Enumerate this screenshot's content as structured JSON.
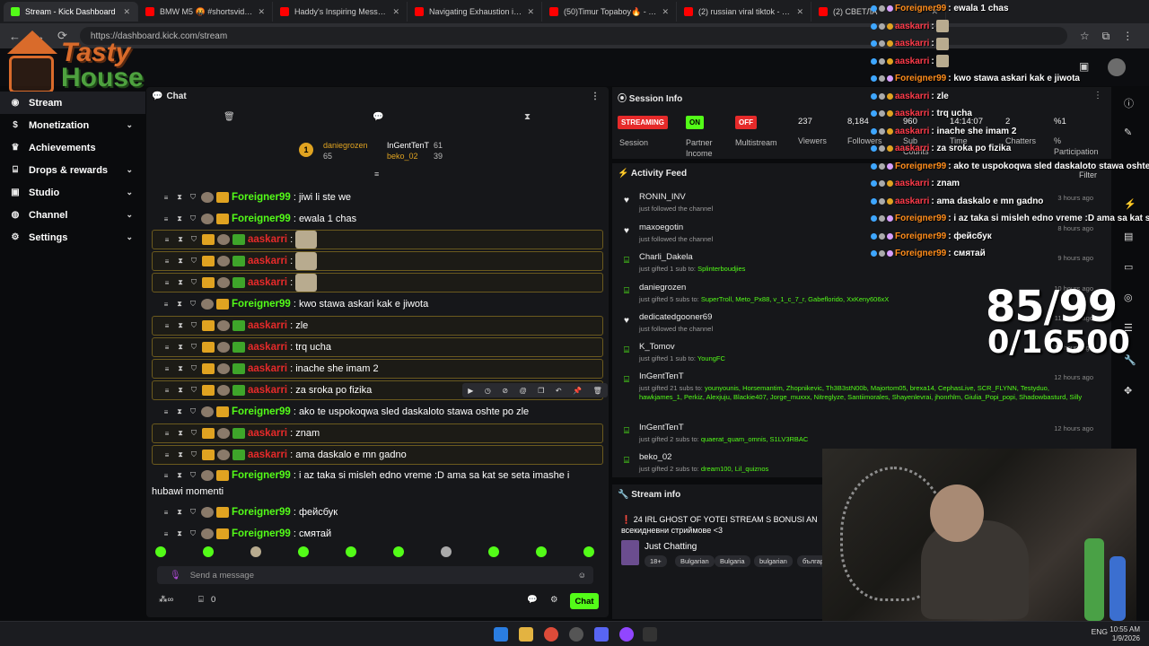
{
  "browser": {
    "tabs": [
      {
        "title": "Stream - Kick Dashboard",
        "color": "#53fc18",
        "active": true
      },
      {
        "title": "BMW M5 🤬 #shortsvideo",
        "color": "#ff0000"
      },
      {
        "title": "Haddy's Inspiring Message Aft",
        "color": "#ff0000"
      },
      {
        "title": "Navigating Exhaustion in Mode",
        "color": "#ff0000"
      },
      {
        "title": "(50)Timur Topaboy🔥 - оригин",
        "color": "#ff0000"
      },
      {
        "title": "(2) russian viral tiktok - YouTub",
        "color": "#ff0000"
      },
      {
        "title": "(2) СВЕТЛА",
        "color": "#ff0000"
      }
    ],
    "url": "https://dashboard.kick.com/stream"
  },
  "logo": {
    "line1": "Tasty",
    "line2": "House"
  },
  "sidebar": {
    "items": [
      {
        "label": "Stream",
        "icon": "broadcast-icon",
        "selected": true
      },
      {
        "label": "Monetization",
        "icon": "dollar-icon",
        "chevron": true
      },
      {
        "label": "Achievements",
        "icon": "trophy-icon"
      },
      {
        "label": "Drops & rewards",
        "icon": "gift-icon",
        "chevron": true
      },
      {
        "label": "Studio",
        "icon": "studio-icon",
        "chevron": true
      },
      {
        "label": "Channel",
        "icon": "user-icon",
        "chevron": true
      },
      {
        "label": "Settings",
        "icon": "gear-icon",
        "chevron": true
      }
    ]
  },
  "chat": {
    "title": "Chat",
    "leaders": [
      {
        "name": "daniegrozen",
        "count": "65"
      },
      {
        "name": "InGentTenT",
        "count": "61"
      },
      {
        "name": "beko_02",
        "count": "39"
      }
    ],
    "rank": "1",
    "messages": [
      {
        "user": "Foreigner99",
        "text": ": jiwi li ste we",
        "style": "green",
        "hl": false,
        "emote": false
      },
      {
        "user": "Foreigner99",
        "text": ": ewala 1 chas",
        "style": "green",
        "hl": false,
        "emote": false
      },
      {
        "user": "aaskarri",
        "text": ":",
        "style": "red",
        "hl": true,
        "emote": true
      },
      {
        "user": "aaskarri",
        "text": ":",
        "style": "red",
        "hl": true,
        "emote": true
      },
      {
        "user": "aaskarri",
        "text": ":",
        "style": "red",
        "hl": true,
        "emote": true
      },
      {
        "user": "Foreigner99",
        "text": ": kwo stawa askari kak e jiwota",
        "style": "green",
        "hl": false,
        "emote": false
      },
      {
        "user": "aaskarri",
        "text": ": zle",
        "style": "red",
        "hl": true,
        "emote": false
      },
      {
        "user": "aaskarri",
        "text": ": trq ucha",
        "style": "red",
        "hl": true,
        "emote": false
      },
      {
        "user": "aaskarri",
        "text": ": inache she imam 2",
        "style": "red",
        "hl": true,
        "emote": false
      },
      {
        "user": "aaskarri",
        "text": ": za sroka po fizika",
        "style": "red",
        "hl": true,
        "emote": false
      },
      {
        "user": "Foreigner99",
        "text": ": ako te uspokoqwa sled daskaloto stawa oshte po zle",
        "style": "green",
        "hl": false,
        "emote": false
      },
      {
        "user": "aaskarri",
        "text": ": znam",
        "style": "red",
        "hl": true,
        "emote": false
      },
      {
        "user": "aaskarri",
        "text": ": ama daskalo e mn gadno",
        "style": "red",
        "hl": true,
        "emote": false
      },
      {
        "user": "Foreigner99",
        "text": ": i az taka si misleh edno vreme :D ama sa kat se seta imashe i",
        "style": "green",
        "hl": false,
        "emote": false,
        "cont": "hubawi momenti"
      },
      {
        "user": "Foreigner99",
        "text": ": фейсбук",
        "style": "green",
        "hl": false,
        "emote": false
      },
      {
        "user": "Foreigner99",
        "text": ": смятай",
        "style": "green",
        "hl": false,
        "emote": false
      }
    ],
    "placeholder": "Send a message",
    "footer_count": "0",
    "chat_button": "Chat"
  },
  "session": {
    "title": "Session Info",
    "streaming": "STREAMING",
    "on": "ON",
    "off": "OFF",
    "session_label": "Session",
    "partner_label": "Partner Income",
    "multistream_label": "Multistream",
    "viewers": "237",
    "viewers_label": "Viewers",
    "followers": "8,184",
    "followers_label": "Followers",
    "subs": "960",
    "subs_label": "Sub Counts",
    "time": "14:14:07",
    "time_label": "Time",
    "chatters": "2",
    "chatters_label": "Chatters",
    "participation": "%1",
    "participation_label": "% Participation"
  },
  "activity": {
    "title": "Activity Feed",
    "filter": "Filter",
    "items": [
      {
        "name": "RONIN_INV",
        "action": "just followed the channel",
        "icon": "heart-icon",
        "time": "3 hours ago",
        "users": ""
      },
      {
        "name": "maxoegotin",
        "action": "just followed the channel",
        "icon": "heart-icon",
        "time": "8 hours ago",
        "users": ""
      },
      {
        "name": "Charli_Dakela",
        "action": "just gifted 1 sub to:",
        "icon": "gift-icon",
        "time": "9 hours ago",
        "users": "Splinterboudjies"
      },
      {
        "name": "daniegrozen",
        "action": "just gifted 5 subs to:",
        "icon": "gift-icon",
        "time": "10 hours ago",
        "users": "SuperTroll, Meto_Px88, v_1_c_7_r, Gabeflorido, XxKeny606xX"
      },
      {
        "name": "dedicatedgooner69",
        "action": "just followed the channel",
        "icon": "heart-icon",
        "time": "11 hours ago",
        "users": ""
      },
      {
        "name": "K_Tomov",
        "action": "just gifted 1 sub to:",
        "icon": "gift-icon",
        "time": "11 hours ago",
        "users": "YoungFC"
      },
      {
        "name": "InGentTenT",
        "action": "just gifted 21 subs to:",
        "icon": "gift-icon",
        "time": "12 hours ago",
        "users": "younyounis, Horsemantim, Zhopnikevic, Th3B3stN00b, Majortom05, brexa14, CephasLive, SCR_FLYNN, Testyduo, hawkjames_1, Perkiz, Alexjuju, Blackie407, Jorge_muxxx, Nitreglyze, Santiimorales, Shayenlevrai, jhonrhlm, Giulia_Popi_popi, Shadowbasturd, Silly"
      },
      {
        "name": "InGentTenT",
        "action": "just gifted 2 subs to:",
        "icon": "gift-icon",
        "time": "12 hours ago",
        "users": "quaerat_quam_omnis, S1LV3RBAC"
      },
      {
        "name": "beko_02",
        "action": "just gifted 2 subs to:",
        "icon": "gift-icon",
        "time": "",
        "users": "dream100, Lil_quiznos"
      }
    ]
  },
  "streaminfo": {
    "title": "Stream info",
    "stream_title": "24 IRL GHOST OF YOTEI STREAM S BONUSI AN",
    "stream_title2": "всекидневни стриймове <3",
    "category": "Just Chatting",
    "tags": [
      "18+",
      "Bulgarian",
      "Bulgaria",
      "bulgarian",
      "българ"
    ]
  },
  "overlay": {
    "lines": [
      {
        "user": "Foreigner99",
        "text": ": ewala 1 chas",
        "kind": "g"
      },
      {
        "user": "aaskarri",
        "text": ":",
        "kind": "r",
        "emote": true
      },
      {
        "user": "aaskarri",
        "text": ":",
        "kind": "r",
        "emote": true
      },
      {
        "user": "aaskarri",
        "text": ":",
        "kind": "r",
        "emote": true
      },
      {
        "user": "Foreigner99",
        "text": ": kwo stawa askari kak e jiwota",
        "kind": "g"
      },
      {
        "user": "aaskarri",
        "text": ": zle",
        "kind": "r"
      },
      {
        "user": "aaskarri",
        "text": ": trq ucha",
        "kind": "r"
      },
      {
        "user": "aaskarri",
        "text": ": inache she imam 2",
        "kind": "r"
      },
      {
        "user": "aaskarri",
        "text": ": za sroka po fizika",
        "kind": "r"
      },
      {
        "user": "Foreigner99",
        "text": ": ako te uspokoqwa sled daskaloto stawa oshte",
        "kind": "g"
      },
      {
        "user": "aaskarri",
        "text": ": znam",
        "kind": "r"
      },
      {
        "user": "aaskarri",
        "text": ": ama daskalo e mn gadno",
        "kind": "r"
      },
      {
        "user": "Foreigner99",
        "text": ": i az taka si misleh edno vreme :D ama sa kat s",
        "kind": "g"
      },
      {
        "user": "Foreigner99",
        "text": ": фейсбук",
        "kind": "g"
      },
      {
        "user": "Foreigner99",
        "text": ": смятай",
        "kind": "g"
      }
    ],
    "counter1": "85/99",
    "counter2": "0/16500"
  },
  "taskbar": {
    "lang": "ENG",
    "time": "10:55 AM",
    "date": "1/9/2026"
  },
  "colors": {
    "kick_green": "#53fc18",
    "red": "#e62a2a",
    "gold": "#e0a321"
  }
}
